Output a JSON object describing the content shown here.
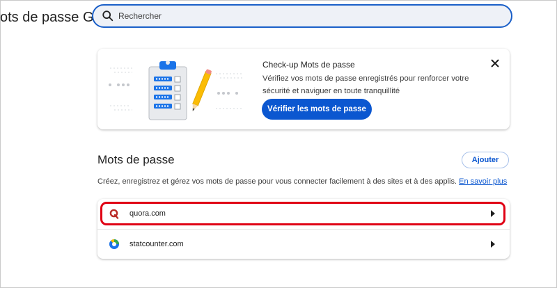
{
  "page": {
    "title": "ots de passe Go"
  },
  "search": {
    "placeholder": "Rechercher",
    "icon": "search-icon"
  },
  "checkup": {
    "title": "Check-up Mots de passe",
    "text": "Vérifiez vos mots de passe enregistrés pour renforcer votre sécurité et naviguer en toute tranquillité",
    "button_label": "Vérifier les mots de passe",
    "close_icon": "close-icon"
  },
  "passwords": {
    "title": "Mots de passe",
    "add_label": "Ajouter",
    "description": "Créez, enregistrez et gérez vos mots de passe pour vous connecter facilement à des sites et à des applis.",
    "learn_more": "En savoir plus",
    "entries": [
      {
        "site": "quora.com",
        "icon": "quora-icon"
      },
      {
        "site": "statcounter.com",
        "icon": "statcounter-icon"
      }
    ]
  },
  "colors": {
    "accent": "#0b57d0",
    "search_border": "#1a5fc8",
    "highlight": "#e00014"
  }
}
